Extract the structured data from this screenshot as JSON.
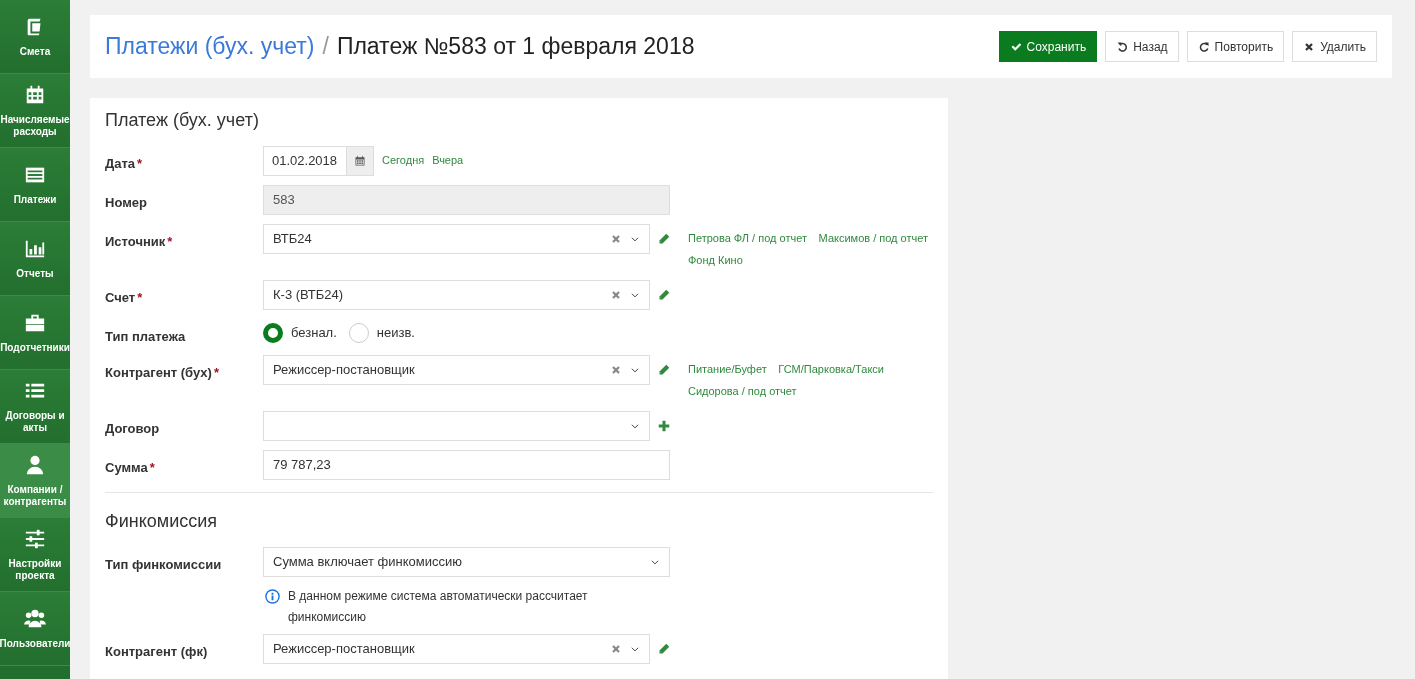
{
  "sidebar": {
    "items": [
      {
        "label": "Смета",
        "selected": false
      },
      {
        "label": "Начисляемые расходы",
        "selected": false
      },
      {
        "label": "Платежи",
        "selected": false
      },
      {
        "label": "Отчеты",
        "selected": false
      },
      {
        "label": "Подотчетники",
        "selected": false
      },
      {
        "label": "Договоры и акты",
        "selected": false
      },
      {
        "label": "Компании / контрагенты",
        "selected": true
      },
      {
        "label": "Настройки проекта",
        "selected": false
      },
      {
        "label": "Пользователи",
        "selected": false
      }
    ]
  },
  "header": {
    "breadcrumb_parent": "Платежи (бух. учет)",
    "separator": "/",
    "title": "Платеж №583 от 1 февраля 2018",
    "buttons": [
      {
        "label": "Сохранить",
        "kind": "save"
      },
      {
        "label": "Назад",
        "kind": "back"
      },
      {
        "label": "Повторить",
        "kind": "repeat"
      },
      {
        "label": "Удалить",
        "kind": "delete"
      }
    ]
  },
  "sections": [
    {
      "title": "Платеж (бух. учет)",
      "divider_after": true,
      "fields": [
        {
          "label": "Дата",
          "required_mark": "*",
          "kind": "date",
          "value": "01.02.2018",
          "shortcuts": [
            "Сегодня",
            "Вчера"
          ]
        },
        {
          "label": "Номер",
          "kind": "readonly",
          "value": "583"
        },
        {
          "label": "Источник",
          "required_mark": "*",
          "kind": "select",
          "value": "ВТБ24",
          "clearable": true,
          "edit_button": true,
          "quick_links": [
            "Петрова ФЛ / под отчет",
            "Максимов / под отчет",
            "Фонд Кино"
          ]
        },
        {
          "label": "Счет",
          "required_mark": "*",
          "kind": "select",
          "value": "К-3 (ВТБ24)",
          "clearable": true,
          "edit_button": true
        },
        {
          "label": "Тип платежа",
          "kind": "radio",
          "options": [
            {
              "label": "безнал.",
              "selected": true
            },
            {
              "label": "неизв.",
              "selected": false
            }
          ]
        },
        {
          "label": "Контрагент (бух)",
          "required_mark": "*",
          "kind": "select",
          "value": "Режиссер-постановщик",
          "clearable": true,
          "edit_button": true,
          "quick_links": [
            "Питание/Буфет",
            "ГСМ/Парковка/Такси",
            "Сидорова / под отчет"
          ]
        },
        {
          "label": "Договор",
          "kind": "select",
          "clearable": false,
          "add_button": true
        },
        {
          "label": "Сумма",
          "required_mark": "*",
          "kind": "text",
          "value": "79 787,23"
        }
      ]
    },
    {
      "title": "Финкомиссия",
      "divider_after": false,
      "fields": [
        {
          "label": "Тип финкомиссии",
          "kind": "dropdown",
          "value": "Сумма включает финкомиссию",
          "note": "В данном режиме система автоматически рассчитает финкомиссию"
        },
        {
          "label": "Контрагент (фк)",
          "kind": "select",
          "value": "Режиссер-постановщик",
          "clearable": true,
          "edit_button": true
        }
      ]
    }
  ]
}
